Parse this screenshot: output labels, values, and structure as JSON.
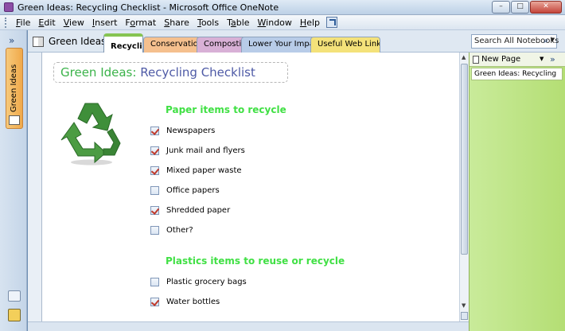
{
  "window": {
    "title": "Green Ideas: Recycling Checklist - Microsoft Office OneNote",
    "minimize": "–",
    "maximize": "□",
    "close": "✕"
  },
  "menu": [
    {
      "label": "File",
      "u": "F",
      "rest": "ile"
    },
    {
      "label": "Edit",
      "u": "E",
      "rest": "dit"
    },
    {
      "label": "View",
      "u": "V",
      "rest": "iew"
    },
    {
      "label": "Insert",
      "u": "I",
      "rest": "nsert"
    },
    {
      "label": "Format",
      "u": "o",
      "pre": "F",
      "rest": "rmat"
    },
    {
      "label": "Share",
      "u": "S",
      "rest": "hare"
    },
    {
      "label": "Tools",
      "u": "T",
      "rest": "ools"
    },
    {
      "label": "Table",
      "u": "a",
      "pre": "T",
      "rest": "ble"
    },
    {
      "label": "Window",
      "u": "W",
      "rest": "indow"
    },
    {
      "label": "Help",
      "u": "H",
      "rest": "elp"
    }
  ],
  "navigation": {
    "collapse": "»",
    "notebook_tab": "Green Ideas"
  },
  "notebook": {
    "name": "Green Ideas"
  },
  "sections": [
    {
      "label": "Recycling",
      "color": "#ffffff",
      "active": true
    },
    {
      "label": "Conservation",
      "color": "#f5c08e",
      "active": false
    },
    {
      "label": "Composti...",
      "color": "#d8b0d6",
      "active": false
    },
    {
      "label": "Lower Your Impact",
      "color": "#b8cce8",
      "active": false
    },
    {
      "label": "Useful Web Links",
      "color": "#f4e27a",
      "active": false
    }
  ],
  "search": {
    "placeholder": "Search All Notebooks"
  },
  "page": {
    "title_prefix": "Green Ideas:",
    "title_suffix": "Recycling Checklist",
    "section1_heading": "Paper items to recycle",
    "section1_items": [
      {
        "label": "Newspapers",
        "checked": true
      },
      {
        "label": "Junk mail and flyers",
        "checked": true
      },
      {
        "label": "Mixed paper waste",
        "checked": true
      },
      {
        "label": "Office papers",
        "checked": false
      },
      {
        "label": "Shredded paper",
        "checked": true
      },
      {
        "label": "Other?",
        "checked": false
      }
    ],
    "section2_heading": "Plastics items to reuse or recycle",
    "section2_items": [
      {
        "label": "Plastic grocery bags",
        "checked": false
      },
      {
        "label": "Water bottles",
        "checked": true
      }
    ],
    "recycle_color": "#3f8f3a"
  },
  "page_pane": {
    "new_page": "New Page",
    "expand": "»",
    "pages": [
      "Green Ideas: Recycling"
    ]
  }
}
